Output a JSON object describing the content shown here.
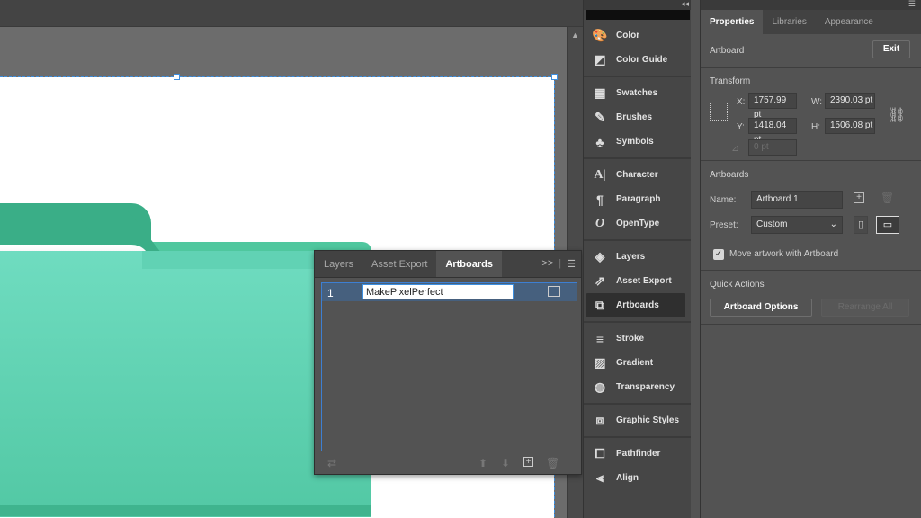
{
  "dock": {
    "items": [
      {
        "label": "Color",
        "icon": "color-palette-icon"
      },
      {
        "label": "Color Guide",
        "icon": "color-guide-icon"
      },
      {
        "label": "Swatches",
        "icon": "swatches-icon"
      },
      {
        "label": "Brushes",
        "icon": "brushes-icon"
      },
      {
        "label": "Symbols",
        "icon": "symbols-icon"
      },
      {
        "label": "Character",
        "icon": "character-icon"
      },
      {
        "label": "Paragraph",
        "icon": "paragraph-icon"
      },
      {
        "label": "OpenType",
        "icon": "opentype-icon"
      },
      {
        "label": "Layers",
        "icon": "layers-icon"
      },
      {
        "label": "Asset Export",
        "icon": "asset-export-icon"
      },
      {
        "label": "Artboards",
        "icon": "artboards-icon"
      },
      {
        "label": "Stroke",
        "icon": "stroke-icon"
      },
      {
        "label": "Gradient",
        "icon": "gradient-icon"
      },
      {
        "label": "Transparency",
        "icon": "transparency-icon"
      },
      {
        "label": "Graphic Styles",
        "icon": "graphic-styles-icon"
      },
      {
        "label": "Pathfinder",
        "icon": "pathfinder-icon"
      },
      {
        "label": "Align",
        "icon": "align-icon"
      }
    ]
  },
  "float_panel": {
    "tabs": [
      "Layers",
      "Asset Export",
      "Artboards"
    ],
    "active_tab": "Artboards",
    "rows": [
      {
        "number": "1",
        "name": "MakePixelPerfect"
      }
    ]
  },
  "properties": {
    "tabs": [
      "Properties",
      "Libraries",
      "Appearance"
    ],
    "active_tab": "Properties",
    "context_label": "Artboard",
    "exit_label": "Exit",
    "transform": {
      "title": "Transform",
      "x_label": "X:",
      "x_value": "1757.99 pt",
      "y_label": "Y:",
      "y_value": "1418.04 pt",
      "w_label": "W:",
      "w_value": "2390.03 pt",
      "h_label": "H:",
      "h_value": "1506.08 pt",
      "angle_value": "0 pt"
    },
    "artboards": {
      "title": "Artboards",
      "name_label": "Name:",
      "name_value": "Artboard 1",
      "preset_label": "Preset:",
      "preset_value": "Custom",
      "move_artwork_label": "Move artwork with Artboard",
      "move_artwork_checked": true
    },
    "quick_actions": {
      "title": "Quick Actions",
      "artboard_options_label": "Artboard Options",
      "rearrange_all_label": "Rearrange All"
    }
  },
  "colors": {
    "folder_front": "#6fdcc0",
    "folder_back": "#3aae87",
    "selection": "#3d8fe0"
  }
}
